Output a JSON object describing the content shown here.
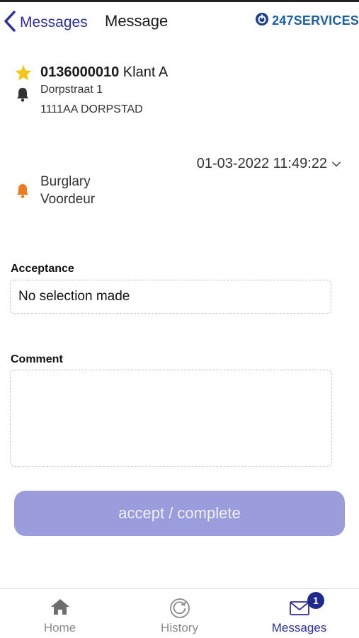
{
  "header": {
    "back_label": "Messages",
    "title": "Message",
    "brand": "247SERVICES"
  },
  "client": {
    "id": "0136000010",
    "name": "Klant A",
    "address_line1": "Dorpstraat 1",
    "address_line2": "1111AA DORPSTAD",
    "icons": [
      "star-icon",
      "bell-icon"
    ]
  },
  "event": {
    "datetime": "01-03-2022 11:49:22",
    "type": "Burglary",
    "location": "Voordeur",
    "icon": "alarm-bell-icon"
  },
  "form": {
    "acceptance_label": "Acceptance",
    "acceptance_value": "No selection made",
    "comment_label": "Comment",
    "comment_value": "",
    "submit_label": "accept / complete"
  },
  "tabbar": {
    "tabs": [
      {
        "label": "Home",
        "icon": "home-icon",
        "active": false
      },
      {
        "label": "History",
        "icon": "history-icon",
        "active": false
      },
      {
        "label": "Messages",
        "icon": "mail-icon",
        "active": true,
        "badge": "1"
      }
    ]
  },
  "colors": {
    "accent": "#2b2f9e",
    "button": "#9a9cdb",
    "star": "#f5c518",
    "alarm_bell": "#f07a1e",
    "brand": "#1b5fa6"
  }
}
